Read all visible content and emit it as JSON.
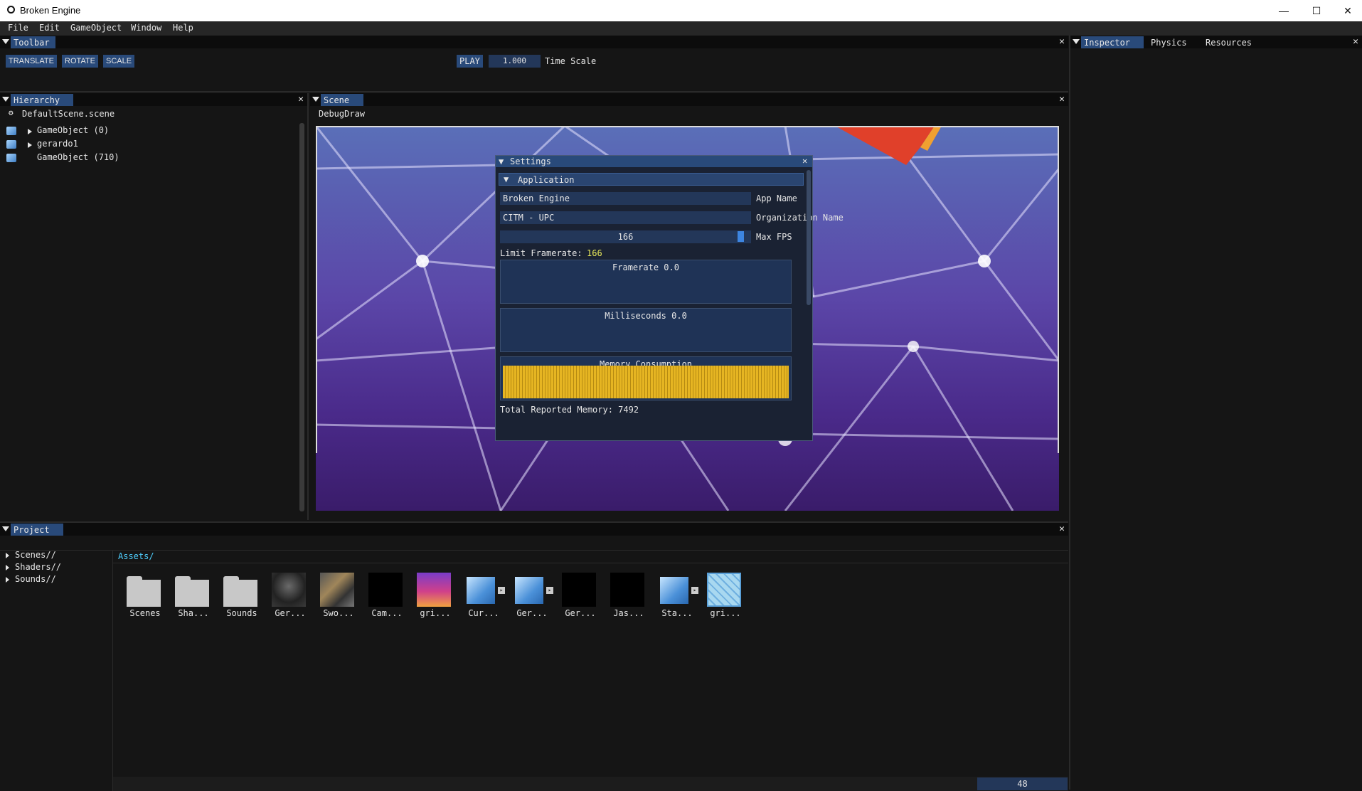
{
  "window": {
    "title": "Broken Engine",
    "minimize": "—",
    "maximize": "☐",
    "close": "✕"
  },
  "menu": [
    "File",
    "Edit",
    "GameObject",
    "Window",
    "Help"
  ],
  "toolbar": {
    "tab": "Toolbar",
    "translate": "TRANSLATE",
    "rotate": "ROTATE",
    "scale": "SCALE",
    "play": "PLAY",
    "time_scale_value": "1.000",
    "time_scale_label": "Time Scale"
  },
  "right_tabs": [
    "Inspector",
    "Physics",
    "Resources"
  ],
  "hierarchy": {
    "tab": "Hierarchy",
    "scene": "DefaultScene.scene",
    "items": [
      "GameObject (0)",
      "gerardo1",
      "GameObject (710)"
    ]
  },
  "scene": {
    "tab": "Scene",
    "debug": "DebugDraw"
  },
  "settings": {
    "title": "Settings",
    "header": "Application",
    "app_name": "Broken Engine",
    "app_name_label": "App Name",
    "org_name": "CITM - UPC",
    "org_name_label": "Organization Name",
    "max_fps": "166",
    "max_fps_label": "Max FPS",
    "limit_label": "Limit Framerate:",
    "limit_value": "166",
    "framerate": "Framerate 0.0",
    "ms": "Milliseconds 0.0",
    "memory": "Memory Consumption",
    "total": "Total Reported Memory: 7492",
    "max_fps_fraction": 0.98
  },
  "project": {
    "tab": "Project",
    "tree": [
      "Scenes//",
      "Shaders//",
      "Sounds//"
    ],
    "path": "Assets/",
    "assets": [
      "Scenes",
      "Sha...",
      "Sounds",
      "Ger...",
      "Swo...",
      "Cam...",
      "gri...",
      "Cur...",
      "Ger...",
      "Ger...",
      "Jas...",
      "Sta...",
      "gri..."
    ],
    "zoom": "48"
  },
  "colors": {
    "accent": "#294a7a",
    "memory_bar": "#e6b522",
    "limit_value": "#e6e65a"
  }
}
